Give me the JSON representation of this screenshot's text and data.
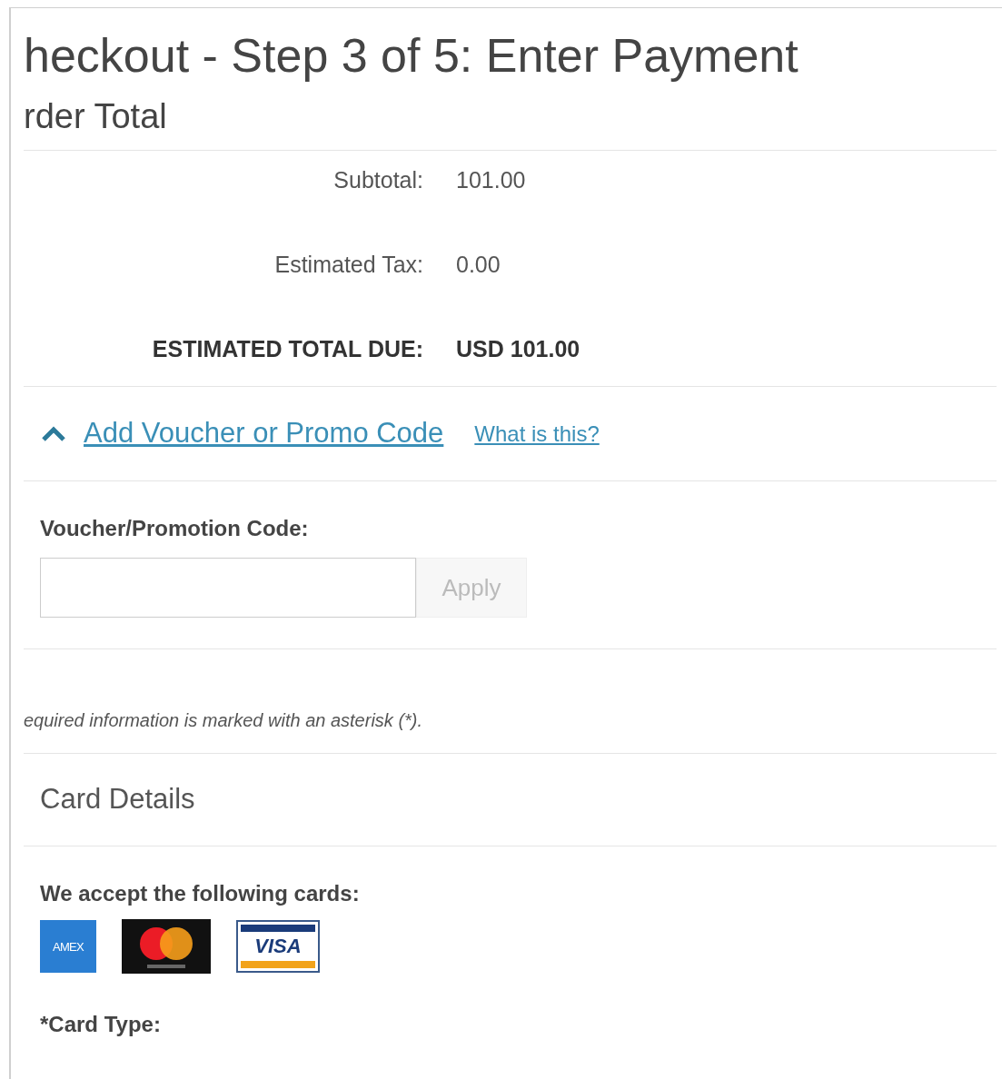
{
  "title": "heckout - Step 3 of 5: Enter Payment",
  "order_total": {
    "heading": "rder Total",
    "rows": [
      {
        "label": "Subtotal:",
        "value": "101.00",
        "kind": "normal"
      },
      {
        "label": "Estimated Tax:",
        "value": "0.00",
        "kind": "normal"
      },
      {
        "label": "ESTIMATED TOTAL DUE:",
        "value": "USD 101.00",
        "kind": "total"
      }
    ]
  },
  "voucher": {
    "toggle": "Add Voucher or Promo Code",
    "expanded": true,
    "help_link": "What is this?",
    "field_label": "Voucher/Promotion Code:",
    "apply_button": {
      "label": "Apply",
      "disabled": true
    }
  },
  "required_note": "equired information is marked with an asterisk (*).",
  "card_details": {
    "heading": "Card Details",
    "accept_label": "We accept the following cards:",
    "cards": [
      {
        "kind": "amex",
        "label": "AMEX"
      },
      {
        "kind": "mastercard"
      },
      {
        "kind": "visa",
        "label": "VISA"
      }
    ],
    "card_type_label": "*Card Type:"
  }
}
